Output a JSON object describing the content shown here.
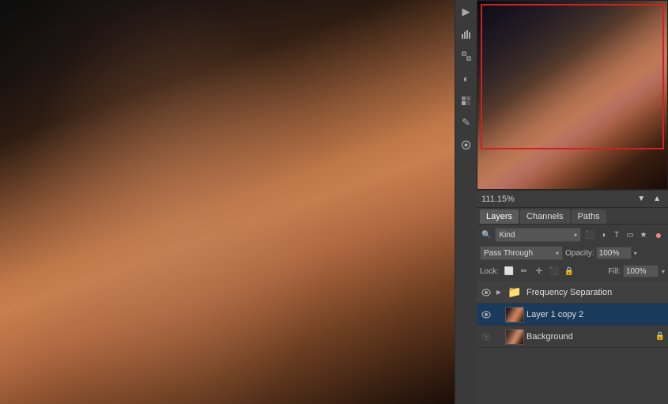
{
  "canvas": {
    "zoom_level": "111.15%"
  },
  "thumbnail": {
    "red_border": true
  },
  "zoom_bar": {
    "zoom": "111.15%"
  },
  "tabs": [
    {
      "id": "layers",
      "label": "Layers",
      "active": true
    },
    {
      "id": "channels",
      "label": "Channels",
      "active": false
    },
    {
      "id": "paths",
      "label": "Paths",
      "active": false
    }
  ],
  "layers_controls": {
    "kind_label": "Kind",
    "blend_mode": "Pass Through",
    "opacity_label": "Opacity:",
    "opacity_value": "100%",
    "lock_label": "Lock:",
    "fill_label": "Fill:",
    "fill_value": "100%"
  },
  "layers": [
    {
      "id": "freq-sep",
      "name": "Frequency Separation",
      "type": "group",
      "visible": true,
      "selected": false
    },
    {
      "id": "layer1copy2",
      "name": "Layer 1 copy 2",
      "type": "layer",
      "visible": true,
      "selected": true
    },
    {
      "id": "background",
      "name": "Background",
      "type": "layer",
      "visible": false,
      "selected": false
    }
  ],
  "tools": [
    {
      "name": "play-icon",
      "symbol": "▶"
    },
    {
      "name": "histogram-icon",
      "symbol": "⬛"
    },
    {
      "name": "info-icon",
      "symbol": "ℹ"
    },
    {
      "name": "color-icon",
      "symbol": "◐"
    },
    {
      "name": "swatches-icon",
      "symbol": "▦"
    },
    {
      "name": "brush-icon",
      "symbol": "✎"
    },
    {
      "name": "clone-icon",
      "symbol": "⊕"
    }
  ]
}
